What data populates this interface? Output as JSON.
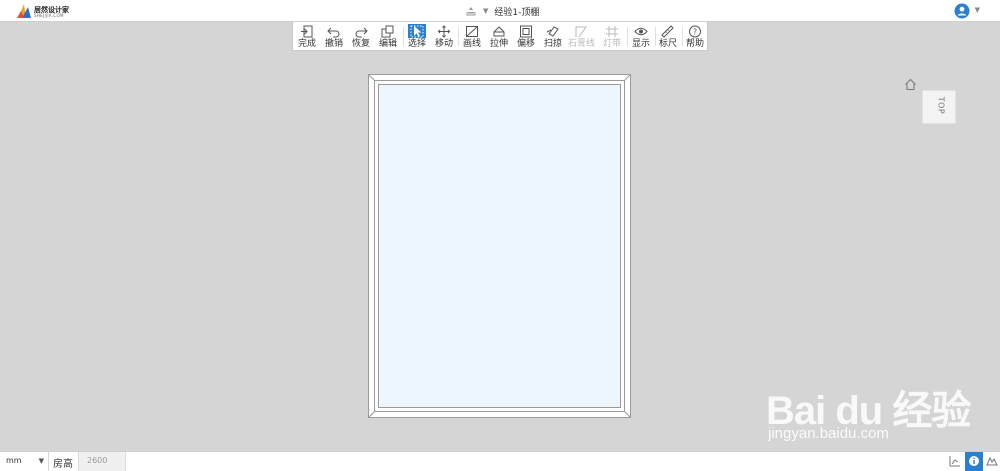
{
  "header": {
    "logo_title": "居然设计家",
    "logo_sub": "SHEJIJIA.COM",
    "doc_title": "经验1-顶棚"
  },
  "toolbar": {
    "items": [
      {
        "label": "完成",
        "icon": "done-icon"
      },
      {
        "label": "撤销",
        "icon": "undo-icon"
      },
      {
        "label": "恢复",
        "icon": "redo-icon"
      },
      {
        "label": "编辑",
        "icon": "edit-icon"
      },
      {
        "label": "选择",
        "icon": "select-icon"
      },
      {
        "label": "移动",
        "icon": "move-icon"
      },
      {
        "label": "画线",
        "icon": "draw-line-icon"
      },
      {
        "label": "拉伸",
        "icon": "extrude-icon"
      },
      {
        "label": "偏移",
        "icon": "offset-icon"
      },
      {
        "label": "扫掠",
        "icon": "sweep-icon"
      },
      {
        "label": "石膏线",
        "icon": "plaster-line-icon"
      },
      {
        "label": "灯带",
        "icon": "light-strip-icon"
      },
      {
        "label": "显示",
        "icon": "eye-icon"
      },
      {
        "label": "标尺",
        "icon": "ruler-icon"
      },
      {
        "label": "帮助",
        "icon": "help-icon"
      }
    ],
    "active": "选择",
    "disabled": [
      "石膏线",
      "灯带"
    ]
  },
  "view": {
    "cube_label": "TOP"
  },
  "status": {
    "unit": "mm",
    "room_height_label": "房高",
    "room_height_value": "2600"
  },
  "watermark": {
    "main": "Bai du 经验",
    "url": "jingyan.baidu.com"
  },
  "colors": {
    "accent": "#2a7fd0",
    "canvas": "#d5d5d5",
    "ceiling_fill": "#eef6fd"
  }
}
